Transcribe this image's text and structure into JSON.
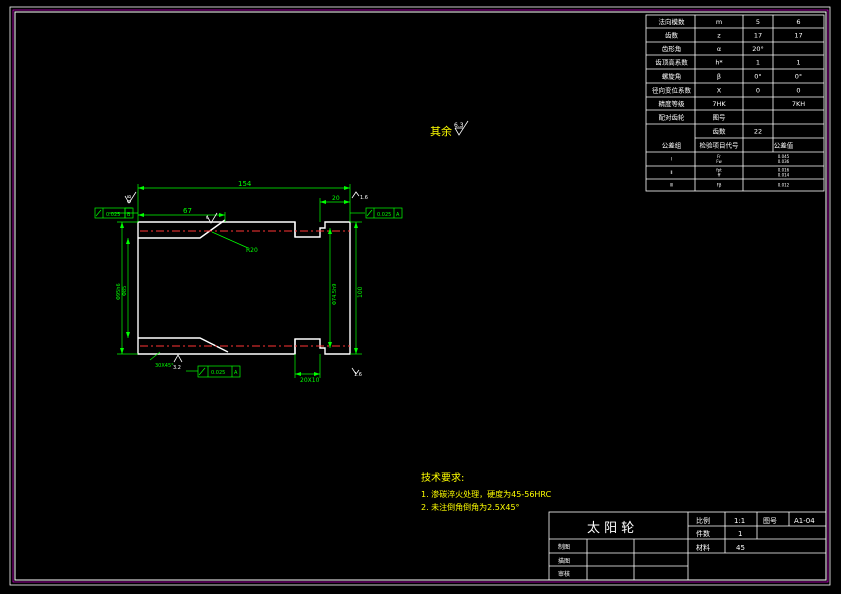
{
  "colors": {
    "background": "#000000",
    "outline": "#ffffff",
    "dimension": "#00ff00",
    "centerline": "#ff0000",
    "frame": "#ff00ff",
    "text_yellow": "#ffff00"
  },
  "param_table": {
    "rows": [
      {
        "name": "法向模数",
        "sym": "m",
        "val": "5",
        "val2": "6"
      },
      {
        "name": "齿数",
        "sym": "z",
        "val": "17",
        "val2": "17"
      },
      {
        "name": "齿形角",
        "sym": "α",
        "val": "20°",
        "val2": ""
      },
      {
        "name": "齿顶高系数",
        "sym": "h*",
        "val": "1",
        "val2": "1"
      },
      {
        "name": "螺旋角",
        "sym": "β",
        "val": "0°",
        "val2": "0°"
      },
      {
        "name": "径向变位系数",
        "sym": "X",
        "val": "0",
        "val2": "0"
      },
      {
        "name": "精度等级",
        "sym": "7HK",
        "val": "",
        "val2": "7KH"
      },
      {
        "name": "配对齿轮",
        "sym": "图号",
        "val": "",
        "val2": ""
      },
      {
        "name": "",
        "sym": "齿数",
        "val": "22",
        "val2": ""
      },
      {
        "name": "公差组",
        "sym": "检验项目代号",
        "val": "公差值",
        "val2": ""
      },
      {
        "name": "Ⅰ",
        "sym": "Fr\nFw",
        "val": "0.045\n0.036",
        "val2": ""
      },
      {
        "name": "Ⅱ",
        "sym": "fpt\nff",
        "val": "0.016\n0.014",
        "val2": ""
      },
      {
        "name": "Ⅲ",
        "sym": "Fβ",
        "val": "0.012",
        "val2": ""
      }
    ]
  },
  "surface_note": {
    "label": "其余",
    "value": "6.3"
  },
  "drawing": {
    "dim_overall": "154",
    "dim_left": "67",
    "dim_groove": "20",
    "dim_groove_bottom": "20X10",
    "dim_right_edge": "1.6",
    "dim_height": "100",
    "dim_bore_left": "Φ85",
    "dim_bore_left_outer": "Φ95h6",
    "dim_inner_right": "Φ74.5h9",
    "dim_radius": "R20",
    "dim_chamfer": "30X45°",
    "roughness_left": "0.8",
    "roughness_small": "1.6",
    "roughness_bottom": "3.2",
    "tol_top_left_value": "0.025",
    "tol_top_left_ref": "B",
    "tol_top_right_value": "0.025",
    "tol_top_right_ref": "A",
    "tol_bottom_value": "0.025",
    "tol_bottom_ref": "A",
    "datum_a": "A",
    "datum_b": "B",
    "label_6": "6"
  },
  "tech_req": {
    "title": "技术要求:",
    "item1": "1. 渗碳淬火处理，硬度为45-56HRC",
    "item2": "2. 未注倒角倒角为2.5X45°"
  },
  "title_block": {
    "part_name": "太 阳 轮",
    "scale_label": "比例",
    "scale_value": "1:1",
    "drawing_no_label": "图号",
    "drawing_no_value": "A1-04",
    "qty_label": "件数",
    "qty_value": "1",
    "material_label": "材料",
    "material_value": "45",
    "drawn_label": "制图",
    "design_label": "描图",
    "check_label": "审核"
  }
}
